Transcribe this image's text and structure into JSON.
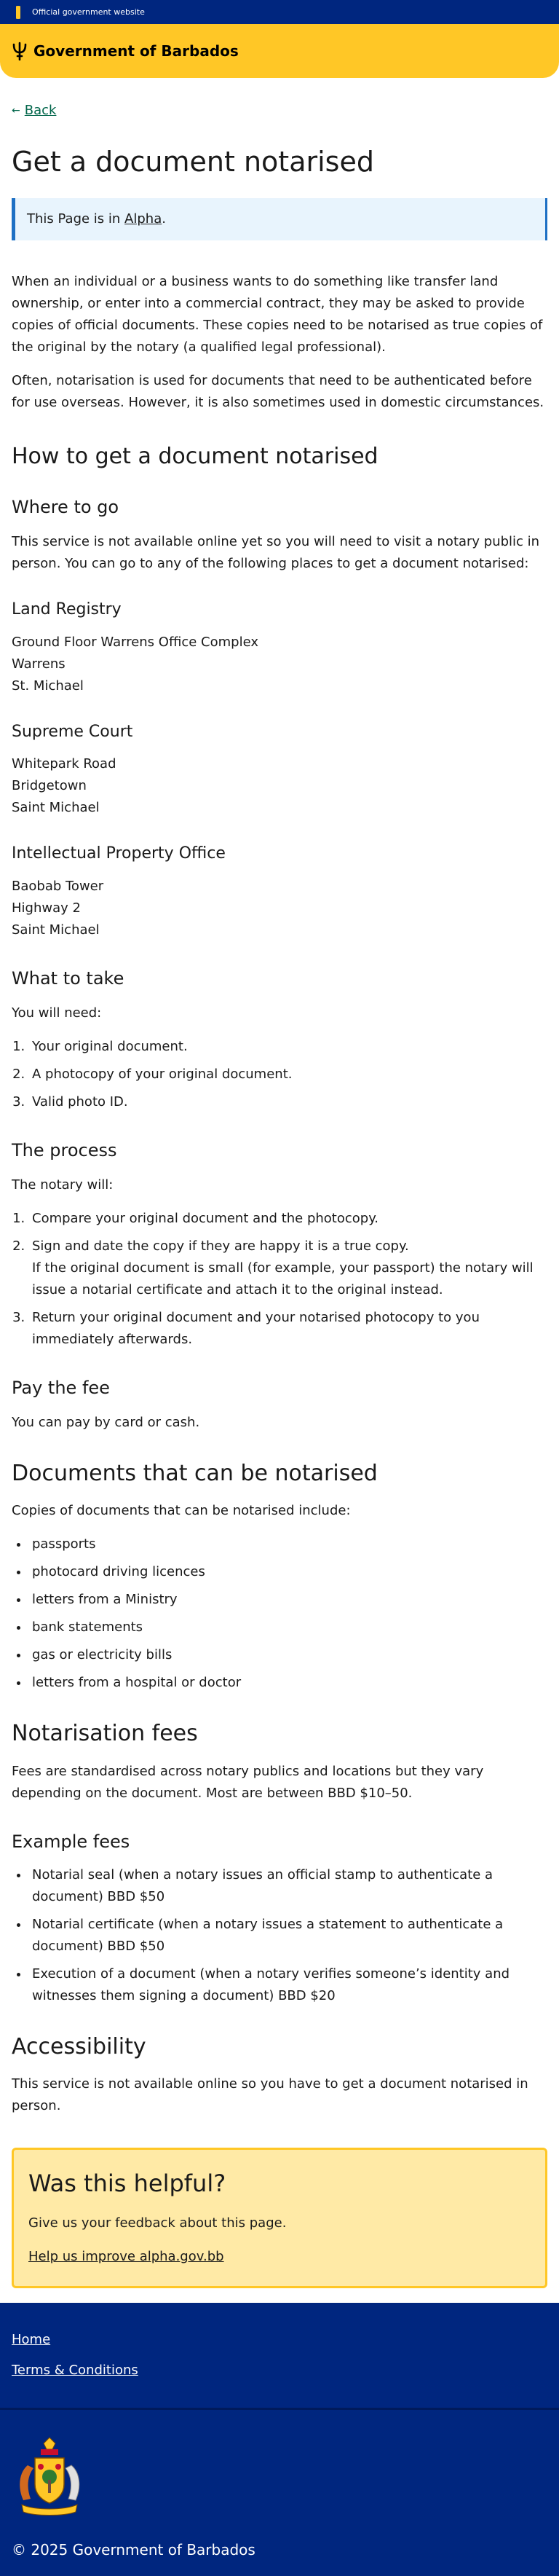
{
  "topbar": {
    "text": "Official government website",
    "flag_colors": [
      "#00267f",
      "#ffc726",
      "#00267f"
    ]
  },
  "header": {
    "brand": "Government of Barbados",
    "bg": "#ffc726"
  },
  "back": {
    "label": "Back"
  },
  "title": "Get a document notarised",
  "alpha": {
    "prefix": "This Page is in ",
    "link": "Alpha",
    "suffix": "."
  },
  "intro": [
    "When an individual or a business wants to do something like transfer land ownership, or enter into a commercial contract, they may be asked to provide copies of official documents. These copies need to be notarised as true copies of the original by the notary (a qualified legal professional).",
    "Often, notarisation is used for documents that need to be authenticated before for use overseas. However, it is also sometimes used in domestic circumstances."
  ],
  "how": {
    "heading": "How to get a document notarised",
    "where": {
      "heading": "Where to go",
      "text": "This service is not available online yet so you will need to visit a notary public in person. You can go to any of the following places to get a document notarised:",
      "places": [
        {
          "name": "Land Registry",
          "lines": [
            "Ground Floor Warrens Office Complex",
            "Warrens",
            "St. Michael"
          ]
        },
        {
          "name": "Supreme Court",
          "lines": [
            "Whitepark Road",
            "Bridgetown",
            "Saint Michael"
          ]
        },
        {
          "name": "Intellectual Property Office",
          "lines": [
            "Baobab Tower",
            "Highway 2",
            "Saint Michael"
          ]
        }
      ]
    },
    "take": {
      "heading": "What to take",
      "text": "You will need:",
      "items": [
        "Your original document.",
        "A photocopy of your original document.",
        "Valid photo ID."
      ]
    },
    "process": {
      "heading": "The process",
      "text": "The notary will:",
      "items": [
        {
          "main": "Compare your original document and the photocopy.",
          "sub": ""
        },
        {
          "main": "Sign and date the copy if they are happy it is a true copy.",
          "sub": "If the original document is small (for example, your passport) the notary will issue a notarial certificate and attach it to the original instead."
        },
        {
          "main": "Return your original document and your notarised photocopy to you immediately afterwards.",
          "sub": ""
        }
      ]
    },
    "fee": {
      "heading": "Pay the fee",
      "text": "You can pay by card or cash."
    }
  },
  "documents": {
    "heading": "Documents that can be notarised",
    "text": "Copies of documents that can be notarised include:",
    "items": [
      "passports",
      "photocard driving licences",
      "letters from a Ministry",
      "bank statements",
      "gas or electricity bills",
      "letters from a hospital or doctor"
    ]
  },
  "fees": {
    "heading": "Notarisation fees",
    "text": "Fees are standardised across notary publics and locations but they vary depending on the document. Most are between BBD $10–50.",
    "example_heading": "Example fees",
    "items": [
      "Notarial seal (when a notary issues an official stamp to authenticate a document) BBD $50",
      "Notarial certificate (when a notary issues a statement to authenticate a document) BBD $50",
      "Execution of a document (when a notary verifies someone’s identity and witnesses them signing a document) BBD $20"
    ]
  },
  "accessibility": {
    "heading": "Accessibility",
    "text": "This service is not available online so you have to get a document notarised in person."
  },
  "feedback": {
    "heading": "Was this helpful?",
    "text": "Give us your feedback about this page.",
    "link": "Help us improve alpha.gov.bb"
  },
  "footer": {
    "links": [
      "Home",
      "Terms & Conditions"
    ],
    "copyright": "© 2025 Government of Barbados"
  }
}
